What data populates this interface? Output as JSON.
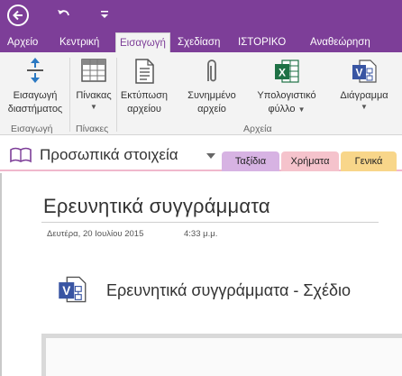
{
  "tabs": [
    {
      "label": "Αρχείο"
    },
    {
      "label": "Κεντρική"
    },
    {
      "label": "Εισαγωγή"
    },
    {
      "label": "Σχεδίαση"
    },
    {
      "label": "ΙΣΤΟΡΙΚΟ"
    },
    {
      "label": "Αναθεώρηση"
    }
  ],
  "ribbon": {
    "insert_space": {
      "line1": "Εισαγωγή",
      "line2": "διαστήματος",
      "icon": "insert-space-icon"
    },
    "table": {
      "label": "Πίνακας",
      "icon": "table-icon"
    },
    "file_printout": {
      "line1": "Εκτύπωση",
      "line2": "αρχείου",
      "icon": "file-printout-icon"
    },
    "file_attachment": {
      "line1": "Συνημμένο",
      "line2": "αρχείο",
      "icon": "paperclip-icon"
    },
    "spreadsheet": {
      "line1": "Υπολογιστικό",
      "line2": "φύλλο",
      "icon": "excel-icon"
    },
    "diagram": {
      "label": "Διάγραμμα",
      "icon": "visio-icon"
    },
    "groups": {
      "insert": "Εισαγωγή",
      "tables": "Πίνακες",
      "files": "Αρχεία"
    }
  },
  "notebook": {
    "title": "Προσωπικά στοιχεία",
    "sections": [
      {
        "label": "Ταξίδια",
        "color": "#d7b3e3"
      },
      {
        "label": "Χρήματα",
        "color": "#f5c3cc"
      },
      {
        "label": "Γενικά",
        "color": "#f8d68a"
      }
    ]
  },
  "page": {
    "title": "Ερευνητικά συγγράμματα",
    "date": "Δευτέρα, 20 Ιουλίου 2015",
    "time": "4:33 μ.μ.",
    "attachment": "Ερευνητικά συγγράμματα - Σχέδιο"
  },
  "colors": {
    "accent": "#7d3e98",
    "ribbon_bg": "#f3f3f3",
    "excel_green": "#1e7145",
    "visio_blue": "#3955a3"
  }
}
